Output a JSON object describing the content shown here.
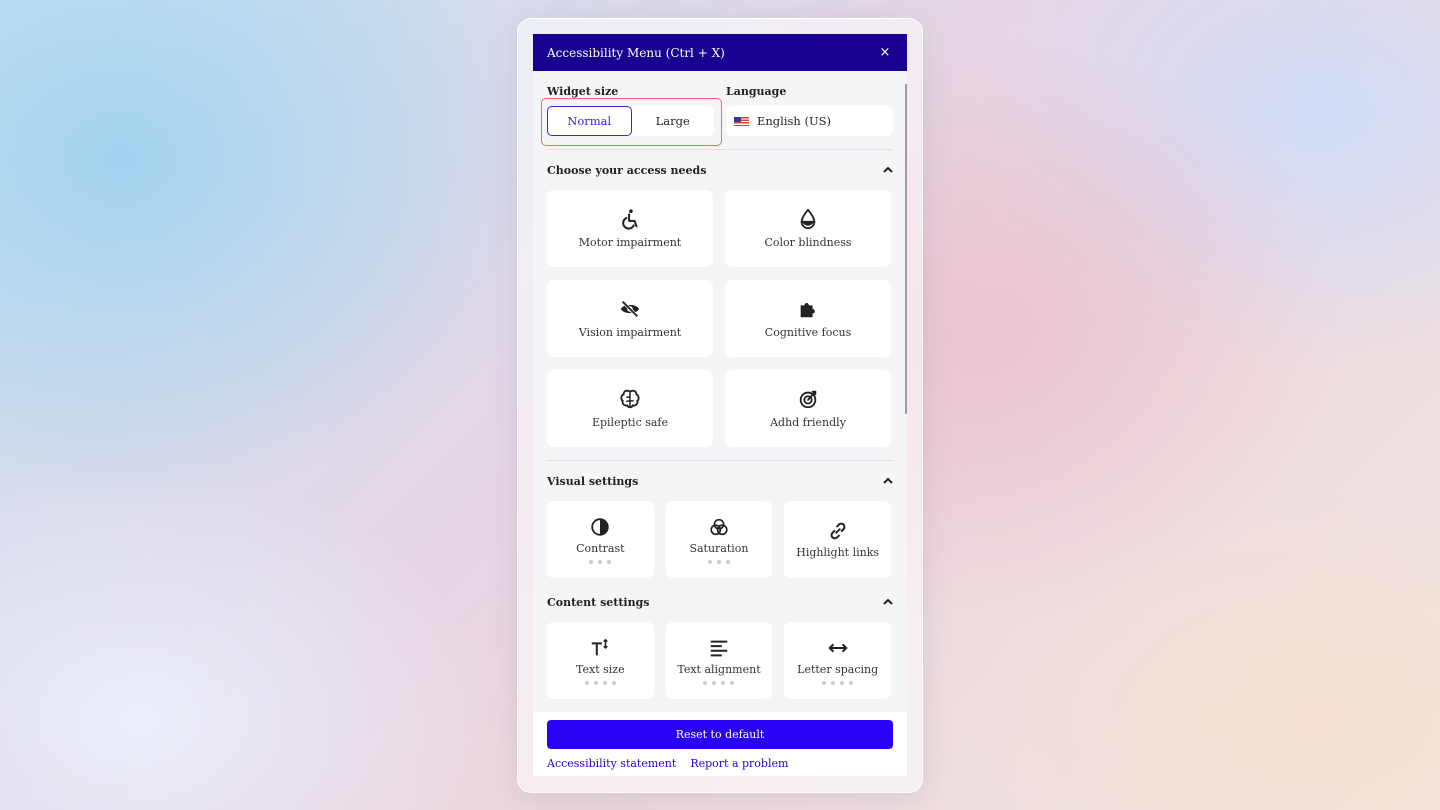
{
  "header": {
    "title": "Accessibility Menu (Ctrl + X)",
    "close": "×"
  },
  "widget_size": {
    "label": "Widget size",
    "options": [
      "Normal",
      "Large"
    ],
    "selected": "Normal"
  },
  "language": {
    "label": "Language",
    "value": "English (US)"
  },
  "access_needs": {
    "title": "Choose your access needs",
    "items": [
      {
        "label": "Motor impairment",
        "icon": "wheelchair-icon"
      },
      {
        "label": "Color blindness",
        "icon": "droplet-half-icon"
      },
      {
        "label": "Vision impairment",
        "icon": "eye-slash-icon"
      },
      {
        "label": "Cognitive focus",
        "icon": "puzzle-icon"
      },
      {
        "label": "Epileptic safe",
        "icon": "brain-icon"
      },
      {
        "label": "Adhd friendly",
        "icon": "target-icon"
      }
    ]
  },
  "visual_settings": {
    "title": "Visual settings",
    "items": [
      {
        "label": "Contrast",
        "icon": "contrast-icon"
      },
      {
        "label": "Saturation",
        "icon": "saturation-icon"
      },
      {
        "label": "Highlight links",
        "icon": "link-icon"
      }
    ]
  },
  "content_settings": {
    "title": "Content settings",
    "items": [
      {
        "label": "Text size",
        "icon": "text-size-icon"
      },
      {
        "label": "Text alignment",
        "icon": "align-left-icon"
      },
      {
        "label": "Letter spacing",
        "icon": "arrows-horizontal-icon"
      }
    ]
  },
  "footer": {
    "reset": "Reset to default",
    "links": [
      "Accessibility statement",
      "Report a problem"
    ]
  },
  "colors": {
    "header": "#1a0090",
    "accent": "#2a00f5",
    "highlight": "#f06a6a"
  }
}
